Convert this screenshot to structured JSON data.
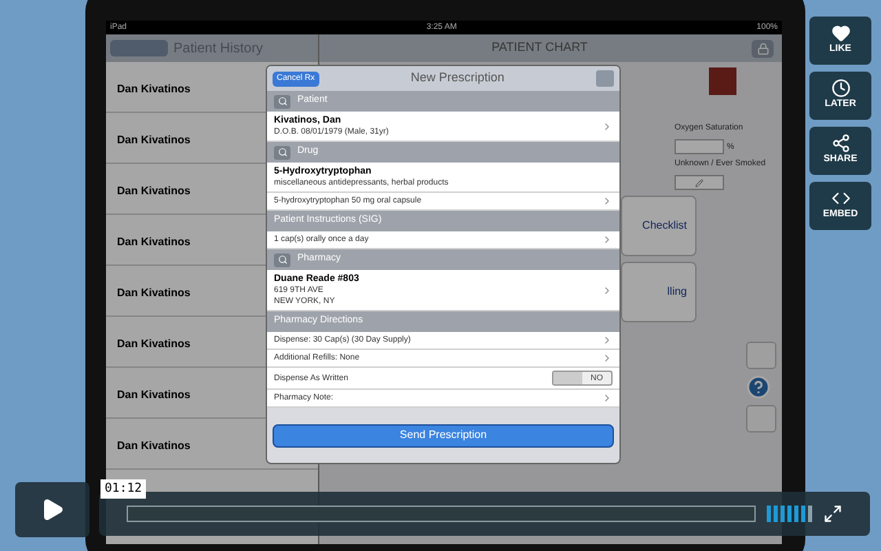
{
  "side_buttons": [
    {
      "kind": "like",
      "label": "LIKE"
    },
    {
      "kind": "later",
      "label": "LATER"
    },
    {
      "kind": "share",
      "label": "SHARE"
    },
    {
      "kind": "embed",
      "label": "EMBED"
    }
  ],
  "ipad": {
    "status_bar": {
      "device": "iPad",
      "time": "3:25 AM",
      "battery": "100%"
    },
    "history": {
      "title": "Patient History",
      "rows": [
        {
          "name": "Dan Kivatinos"
        },
        {
          "name": "Dan Kivatinos"
        },
        {
          "name": "Dan Kivatinos"
        },
        {
          "name": "Dan Kivatinos"
        },
        {
          "name": "Dan Kivatinos"
        },
        {
          "name": "Dan Kivatinos"
        },
        {
          "name": "Dan Kivatinos"
        },
        {
          "name": "Dan Kivatinos"
        }
      ]
    },
    "chart": {
      "title": "PATIENT CHART",
      "oxygen_label": "Oxygen Saturation",
      "oxygen_unit": "%",
      "smoking_label": "Unknown / Ever Smoked",
      "cards": [
        {
          "label": "Checklist"
        },
        {
          "label": "lling"
        }
      ]
    },
    "modal": {
      "cancel": "Cancel Rx",
      "title": "New Prescription",
      "sections": [
        {
          "title": "Patient",
          "search": true,
          "rows": [
            {
              "lines": [
                {
                  "kind": "bold",
                  "text": "Kivatinos, Dan"
                },
                {
                  "kind": "small",
                  "text": "D.O.B. 08/01/1979 (Male, 31yr)"
                }
              ],
              "chevron": true
            }
          ]
        },
        {
          "title": "Drug",
          "search": true,
          "rows": [
            {
              "lines": [
                {
                  "kind": "bold",
                  "text": "5-Hydroxytryptophan"
                },
                {
                  "kind": "small",
                  "text": "miscellaneous antidepressants, herbal products"
                }
              ],
              "chevron": false
            },
            {
              "lines": [
                {
                  "kind": "small",
                  "text": "5-hydroxytryptophan 50 mg oral capsule"
                }
              ],
              "chevron": true
            }
          ]
        },
        {
          "title": "Patient Instructions (SIG)",
          "search": false,
          "rows": [
            {
              "lines": [
                {
                  "kind": "small",
                  "text": "1 cap(s) orally once a day"
                }
              ],
              "chevron": true
            }
          ]
        },
        {
          "title": "Pharmacy",
          "search": true,
          "rows": [
            {
              "lines": [
                {
                  "kind": "bold",
                  "text": "Duane Reade #803"
                },
                {
                  "kind": "small",
                  "text": "619 9TH AVE"
                },
                {
                  "kind": "small",
                  "text": "NEW YORK, NY"
                }
              ],
              "chevron": true
            }
          ]
        },
        {
          "title": "Pharmacy Directions",
          "search": false,
          "rows": [
            {
              "lines": [
                {
                  "kind": "small",
                  "text": "Dispense: 30 Cap(s) (30 Day Supply)"
                }
              ],
              "chevron": true
            },
            {
              "lines": [
                {
                  "kind": "small",
                  "text": "Additional Refills: None"
                }
              ],
              "chevron": true
            },
            {
              "lines": [
                {
                  "kind": "small",
                  "text": "Dispense As Written"
                }
              ],
              "chevron": false,
              "toggle": {
                "on": false,
                "label": "NO"
              }
            },
            {
              "lines": [
                {
                  "kind": "small",
                  "text": "Pharmacy Note:"
                }
              ],
              "chevron": true
            }
          ]
        }
      ],
      "send": "Send Prescription"
    }
  },
  "player": {
    "time": "01:12",
    "playing": false,
    "volume": {
      "level": 0.85
    }
  }
}
